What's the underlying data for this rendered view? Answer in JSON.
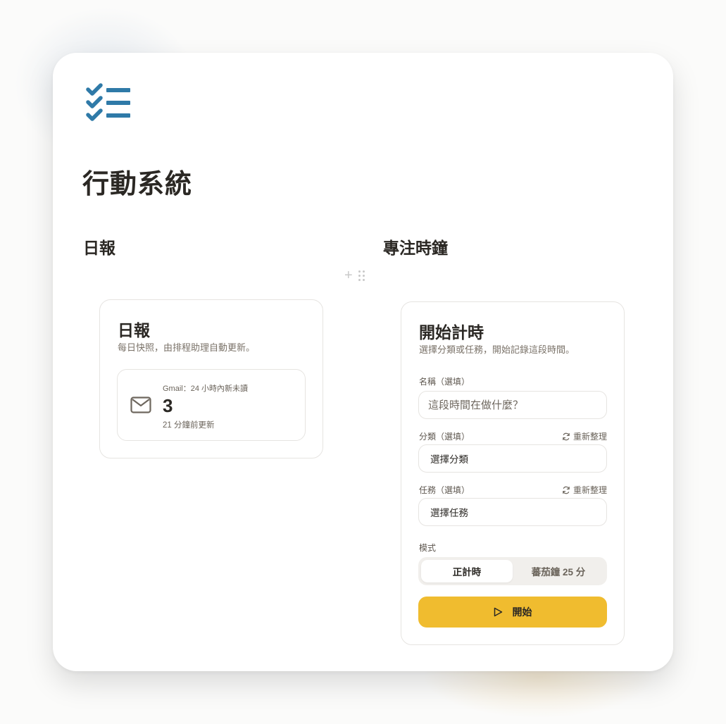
{
  "page": {
    "title": "行動系統",
    "logo_icon": "checklist-icon",
    "accent_color": "#2f7aa8"
  },
  "sections": {
    "left_heading": "日報",
    "right_heading": "專注時鐘"
  },
  "daily_report": {
    "title": "日報",
    "description": "每日快照，由排程助理自動更新。",
    "gmail": {
      "icon": "mail-icon",
      "label": "Gmail：24 小時內新未讀",
      "count": "3",
      "updated": "21 分鐘前更新"
    }
  },
  "timer": {
    "title": "開始計時",
    "description": "選擇分類或任務，開始記錄這段時間。",
    "name_label": "名稱（選填）",
    "name_placeholder": "這段時間在做什麼？",
    "category_label": "分類（選填）",
    "category_refresh": "重新整理",
    "category_value": "選擇分類",
    "task_label": "任務（選填）",
    "task_refresh": "重新整理",
    "task_value": "選擇任務",
    "mode_label": "模式",
    "modes": [
      "正計時",
      "蕃茄鐘 25 分"
    ],
    "active_mode": "正計時",
    "start_label": "開始",
    "start_color": "#f0bc2f"
  }
}
